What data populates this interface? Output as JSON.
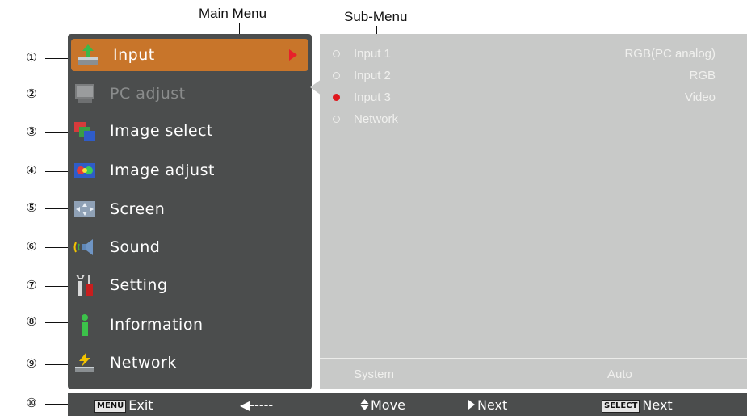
{
  "labels": {
    "main_menu": "Main Menu",
    "sub_menu": "Sub-Menu"
  },
  "callouts": [
    "①",
    "②",
    "③",
    "④",
    "⑤",
    "⑥",
    "⑦",
    "⑧",
    "⑨",
    "⑩"
  ],
  "menu": [
    {
      "label": "Input",
      "icon": "input-icon",
      "state": "selected"
    },
    {
      "label": "PC adjust",
      "icon": "monitor-icon",
      "state": "disabled"
    },
    {
      "label": "Image select",
      "icon": "image-select-icon",
      "state": "normal"
    },
    {
      "label": "Image adjust",
      "icon": "image-adjust-icon",
      "state": "normal"
    },
    {
      "label": "Screen",
      "icon": "screen-icon",
      "state": "normal"
    },
    {
      "label": "Sound",
      "icon": "speaker-icon",
      "state": "normal"
    },
    {
      "label": "Setting",
      "icon": "wrench-screwdriver-icon",
      "state": "normal"
    },
    {
      "label": "Information",
      "icon": "info-icon",
      "state": "normal"
    },
    {
      "label": "Network",
      "icon": "network-icon",
      "state": "normal"
    }
  ],
  "submenu": [
    {
      "name": "Input 1",
      "value": "RGB(PC analog)",
      "active": false
    },
    {
      "name": "Input 2",
      "value": "RGB",
      "active": false
    },
    {
      "name": "Input 3",
      "value": "Video",
      "active": true
    },
    {
      "name": "Network",
      "value": "",
      "active": false
    }
  ],
  "system": {
    "label": "System",
    "value": "Auto"
  },
  "status_bar": {
    "menu_key": "MENU",
    "exit": "Exit",
    "back": "◀-----",
    "move": "Move",
    "next1": "Next",
    "select_key": "SELECT",
    "next2": "Next"
  },
  "colors": {
    "menu_bg": "#4b4d4d",
    "selected": "#c8752a",
    "submenu_bg": "#c8c9c8",
    "active_dot": "#e0161c"
  }
}
